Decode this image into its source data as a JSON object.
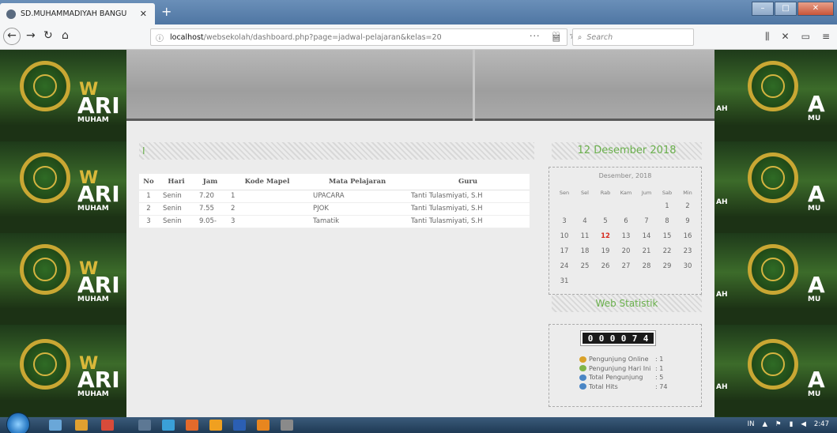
{
  "browser": {
    "tab_title": "SD.MUHAMMADIYAH BANGU",
    "tab_close": "✕",
    "new_tab": "+",
    "url_host": "localhost",
    "url_path": "/websekolah/dashboard.php?page=jadwal-pelajaran&kelas=20",
    "search_placeholder": "Search",
    "overflow": "···"
  },
  "page": {
    "main_heading": "I",
    "table": {
      "headers": [
        "No",
        "Hari",
        "Jam",
        "Kode Mapel",
        "Mata Pelajaran",
        "Guru"
      ],
      "rows": [
        [
          "1",
          "Senin",
          "7.20",
          "1",
          "UPACARA",
          "Tanti Tulasmiyati, S.H"
        ],
        [
          "2",
          "Senin",
          "7.55",
          "2",
          "PJOK",
          "Tanti Tulasmiyati, S.H"
        ],
        [
          "3",
          "Senin",
          "9.05-",
          "3",
          "Tamatik",
          "Tanti Tulasmiyati, S.H"
        ]
      ]
    },
    "date_heading": "12 Desember 2018",
    "calendar": {
      "caption": "Desember, 2018",
      "day_headers": [
        "Sen",
        "Sel",
        "Rab",
        "Kam",
        "Jum",
        "Sab",
        "Min"
      ],
      "days": [
        "",
        "",
        "",
        "",
        "",
        "1",
        "2",
        "3",
        "4",
        "5",
        "6",
        "7",
        "8",
        "9",
        "10",
        "11",
        "12",
        "13",
        "14",
        "15",
        "16",
        "17",
        "18",
        "19",
        "20",
        "21",
        "22",
        "23",
        "24",
        "25",
        "26",
        "27",
        "28",
        "29",
        "30",
        "31"
      ],
      "today": "12"
    },
    "stat_heading": "Web Statistik",
    "counter_digits": [
      "0",
      "0",
      "0",
      "0",
      "7",
      "4"
    ],
    "stats": [
      {
        "label": "Pengunjung Online",
        "value": ": 1"
      },
      {
        "label": "Pengunjung Hari Ini",
        "value": ": 1"
      },
      {
        "label": "Total Pengunjung",
        "value": ": 5"
      },
      {
        "label": "Total Hits",
        "value": ": 74"
      }
    ]
  },
  "sidebar_text": {
    "big": "ARI",
    "small": "MUHAM",
    "w": "W",
    "right_partial": "AH",
    "right_far": "A",
    "right_far_small": "MU"
  },
  "taskbar": {
    "lang": "IN",
    "time": "2:47"
  },
  "colors": {
    "accent_green": "#6ab04c",
    "today_red": "#d62b1f"
  }
}
